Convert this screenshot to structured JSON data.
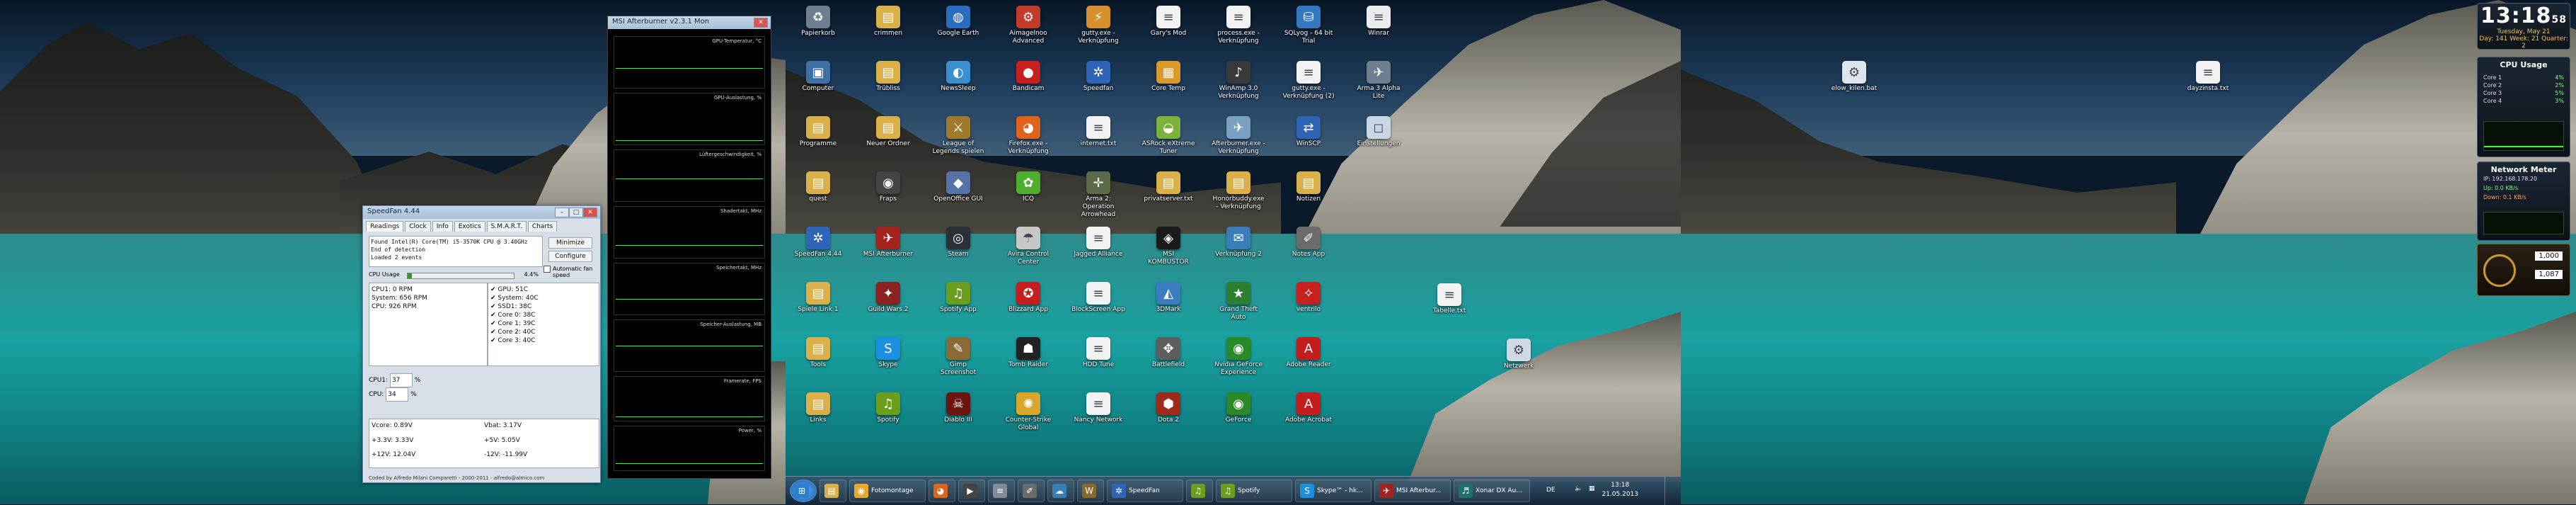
{
  "colors": {
    "lake": "#1aa1a1",
    "taskbar": "#23384f",
    "graph": "#34ff34",
    "gadget_accent": "#f3c24a"
  },
  "speedfan": {
    "title": "SpeedFan 4.44",
    "tabs": [
      "Readings",
      "Clock",
      "Info",
      "Exotics",
      "S.M.A.R.T.",
      "Charts"
    ],
    "log_lines": [
      "Found Intel(R) Core(TM) i5-3570K CPU @ 3.40GHz",
      "End of detection",
      "Loaded 2 events"
    ],
    "buttons": {
      "minimize": "Minimize",
      "configure": "Configure"
    },
    "auto_fan_label": "Automatic fan speed",
    "cpu_usage_label": "CPU Usage",
    "cpu_usage_value": "4.4%",
    "fans": [
      "CPU1: 0 RPM",
      "System: 656 RPM",
      "CPU: 926 RPM"
    ],
    "temps": [
      "GPU: 51C",
      "System: 40C",
      "SSD1: 38C",
      "Core 0: 38C",
      "Core 1: 39C",
      "Core 2: 40C",
      "Core 3: 40C"
    ],
    "speed_rows": [
      {
        "label": "CPU1:",
        "value": "37"
      },
      {
        "label": "CPU:",
        "value": "34"
      }
    ],
    "volts": [
      "Vcore: 0.89V",
      "Vbat: 3.17V",
      "+3.3V: 3.33V",
      "+5V: 5.05V",
      "+12V: 12.04V",
      "-12V: -11.99V"
    ],
    "footer": "Coded by Alfredo Milani Comparetti - 2000-2011 - alfredo@almico.com"
  },
  "afterburner": {
    "title": "MSI Afterburner v2.3.1 Mon",
    "graphs": [
      "GPU-Temperatur, °C",
      "GPU-Auslastung, %",
      "Lüftergeschwindigkeit, %",
      "Shadertakt, MHz",
      "Speichertakt, MHz",
      "Speicher-Auslastung, MB",
      "Framerate, FPS",
      "Power, %"
    ]
  },
  "desktop": {
    "icons": [
      {
        "label": "Papierkorb",
        "icon": "trash-icon",
        "color": "#6f7f8f",
        "glyph": "♻"
      },
      {
        "label": "Computer",
        "icon": "computer-icon",
        "color": "#3e6fa5",
        "glyph": "▣"
      },
      {
        "label": "Programme",
        "icon": "folder-icon",
        "color": "#d9b04a",
        "glyph": "▤"
      },
      {
        "label": "quest",
        "icon": "folder-icon",
        "color": "#d9b04a",
        "glyph": "▤"
      },
      {
        "label": "SpeedFan 4.44",
        "icon": "speedfan-icon",
        "color": "#2f64b8",
        "glyph": "✲"
      },
      {
        "label": "Spiele Link 1",
        "icon": "folder-icon",
        "color": "#d9b04a",
        "glyph": "▤"
      },
      {
        "label": "Tools",
        "icon": "folder-icon",
        "color": "#d9b04a",
        "glyph": "▤"
      },
      {
        "label": "Links",
        "icon": "folder-icon",
        "color": "#d9b04a",
        "glyph": "▤"
      },
      {
        "label": "crimmen",
        "icon": "folder-icon",
        "color": "#d9b04a",
        "glyph": "▤"
      },
      {
        "label": "Trübliss",
        "icon": "folder-icon",
        "color": "#d9b04a",
        "glyph": "▤"
      },
      {
        "label": "Neuer Ordner",
        "icon": "folder-icon",
        "color": "#d9b04a",
        "glyph": "▤"
      },
      {
        "label": "Fraps",
        "icon": "fraps-icon",
        "color": "#444",
        "glyph": "◉"
      },
      {
        "label": "MSI Afterburner",
        "icon": "afterburner-icon",
        "color": "#a3241f",
        "glyph": "✈"
      },
      {
        "label": "Guild Wars 2",
        "icon": "game-icon",
        "color": "#8a2320",
        "glyph": "✦"
      },
      {
        "label": "Skype",
        "icon": "skype-icon",
        "color": "#1d8fe0",
        "glyph": "S"
      },
      {
        "label": "Spotify",
        "icon": "spotify-icon",
        "color": "#6a9e1c",
        "glyph": "♫"
      },
      {
        "label": "Google Earth",
        "icon": "earth-icon",
        "color": "#2a6dbf",
        "glyph": "◍"
      },
      {
        "label": "NewsSleep",
        "icon": "app-icon",
        "color": "#3a8fcf",
        "glyph": "◐"
      },
      {
        "label": "League of Legends spielen",
        "icon": "game-icon",
        "color": "#9d7a2c",
        "glyph": "⚔"
      },
      {
        "label": "OpenOffice GUI",
        "icon": "app-icon",
        "color": "#5672a6",
        "glyph": "◆"
      },
      {
        "label": "Steam",
        "icon": "steam-icon",
        "color": "#2a2f38",
        "glyph": "◎"
      },
      {
        "label": "Spotify App",
        "icon": "spotify-icon",
        "color": "#6a9e1c",
        "glyph": "♫"
      },
      {
        "label": "Gimp Screenshot",
        "icon": "gimp-icon",
        "color": "#8a6a38",
        "glyph": "✎"
      },
      {
        "label": "Diablo III",
        "icon": "game-icon",
        "color": "#6b1510",
        "glyph": "☠"
      },
      {
        "label": "Aimagelnoo Advanced",
        "icon": "app-icon",
        "color": "#c13a2a",
        "glyph": "⚙"
      },
      {
        "label": "Bandicam",
        "icon": "record-icon",
        "color": "#c62020",
        "glyph": "●"
      },
      {
        "label": "Firefox.exe - Verknüpfung",
        "icon": "firefox-icon",
        "color": "#e0631d",
        "glyph": "◕"
      },
      {
        "label": "ICQ",
        "icon": "icq-icon",
        "color": "#4fae2e",
        "glyph": "✿"
      },
      {
        "label": "Avira Control Center",
        "icon": "avira-icon",
        "color": "#c7c7c7",
        "glyph": "☂"
      },
      {
        "label": "Blizzard App",
        "icon": "game-icon",
        "color": "#c41e1e",
        "glyph": "✪"
      },
      {
        "label": "Tomb Raider",
        "icon": "game-icon",
        "color": "#222",
        "glyph": "☗"
      },
      {
        "label": "Counter-Strike Global",
        "icon": "game-icon",
        "color": "#d9a52a",
        "glyph": "✺"
      },
      {
        "label": "gutty.exe - Verknüpfung",
        "icon": "app-icon",
        "color": "#d88f2d",
        "glyph": "⚡"
      },
      {
        "label": "Speedfan",
        "icon": "speedfan-icon",
        "color": "#2f64b8",
        "glyph": "✲"
      },
      {
        "label": "internet.txt",
        "icon": "text-file-icon",
        "color": "#f2f2f2",
        "glyph": "≡"
      },
      {
        "label": "Arma 2: Operation Arrowhead",
        "icon": "game-icon",
        "color": "#5d6b4a",
        "glyph": "✛"
      },
      {
        "label": "Jagged Alliance",
        "icon": "text-file-icon",
        "color": "#f2f2f2",
        "glyph": "≡"
      },
      {
        "label": "BlockScreen App",
        "icon": "text-file-icon",
        "color": "#f2f2f2",
        "glyph": "≡"
      },
      {
        "label": "HDD Tune",
        "icon": "text-file-icon",
        "color": "#f2f2f2",
        "glyph": "≡"
      },
      {
        "label": "Nancy Network",
        "icon": "text-file-icon",
        "color": "#f2f2f2",
        "glyph": "≡"
      },
      {
        "label": "Gary's Mod",
        "icon": "text-file-icon",
        "color": "#f2f2f2",
        "glyph": "≡"
      },
      {
        "label": "Core Temp",
        "icon": "temp-icon",
        "color": "#d99a2b",
        "glyph": "▦"
      },
      {
        "label": "ASRock eXtreme Tuner",
        "icon": "app-icon",
        "color": "#7ab23b",
        "glyph": "◒"
      },
      {
        "label": "privatserver.txt",
        "icon": "folder-icon",
        "color": "#d9b04a",
        "glyph": "▤"
      },
      {
        "label": "MSI KOMBUSTOR",
        "icon": "app-icon",
        "color": "#1a1a1a",
        "glyph": "◈"
      },
      {
        "label": "3DMark",
        "icon": "app-icon",
        "color": "#3b7dc0",
        "glyph": "◭"
      },
      {
        "label": "Battlefield",
        "icon": "game-icon",
        "color": "#5e5e5e",
        "glyph": "✥"
      },
      {
        "label": "Dota 2",
        "icon": "game-icon",
        "color": "#9e2a1c",
        "glyph": "⬢"
      },
      {
        "label": "process.exe - Verknüpfung",
        "icon": "text-file-icon",
        "color": "#f2f2f2",
        "glyph": "≡"
      },
      {
        "label": "WinAmp 3.0 Verknüpfung",
        "icon": "app-icon",
        "color": "#3a3a3a",
        "glyph": "♪"
      },
      {
        "label": "Afterburner.exe - Verknüpfung",
        "icon": "app-icon",
        "color": "#7aa0c4",
        "glyph": "✈"
      },
      {
        "label": "Honorbuddy.exe - Verknüpfung",
        "icon": "folder-icon",
        "color": "#d9b04a",
        "glyph": "▤"
      },
      {
        "label": "Verknüpfung 2",
        "icon": "mail-icon",
        "color": "#3a7db8",
        "glyph": "✉"
      },
      {
        "label": "Grand Theft Auto",
        "icon": "game-icon",
        "color": "#2f7f33",
        "glyph": "★"
      },
      {
        "label": "Nvidia GeForce Experience",
        "icon": "nvidia-icon",
        "color": "#2a8a2a",
        "glyph": "◉"
      },
      {
        "label": "GeForce",
        "icon": "nvidia-icon",
        "color": "#2a8a2a",
        "glyph": "◉"
      },
      {
        "label": "SQLyog - 64 bit Trial",
        "icon": "database-icon",
        "color": "#3277c0",
        "glyph": "⛁"
      },
      {
        "label": "gutty.exe - Verknüpfung (2)",
        "icon": "text-file-icon",
        "color": "#f2f2f2",
        "glyph": "≡"
      },
      {
        "label": "WinSCP",
        "icon": "winscp-icon",
        "color": "#2f63b3",
        "glyph": "⇄"
      },
      {
        "label": "Notizen",
        "icon": "folder-icon",
        "color": "#d9b04a",
        "glyph": "▤"
      },
      {
        "label": "Notes App",
        "icon": "app-icon",
        "color": "#6b6b6b",
        "glyph": "✐"
      },
      {
        "label": "ventrilo",
        "icon": "app-icon",
        "color": "#c62020",
        "glyph": "✧"
      },
      {
        "label": "Adobe Reader",
        "icon": "pdf-icon",
        "color": "#c41d1d",
        "glyph": "A"
      },
      {
        "label": "Adobe Acrobat",
        "icon": "pdf-icon",
        "color": "#c41d1d",
        "glyph": "A"
      },
      {
        "label": "Winrar",
        "icon": "app-icon",
        "color": "#ececec",
        "glyph": "≡"
      },
      {
        "label": "Arma 3 Alpha Lite",
        "icon": "game-icon",
        "color": "#6f7f8f",
        "glyph": "✈"
      },
      {
        "label": "Einstellungen",
        "icon": "app-icon",
        "color": "#c8d6e6",
        "glyph": "◻"
      }
    ],
    "second_monitor_icons": [
      {
        "label": "elow_kilen.bat",
        "icon": "batch-file-icon",
        "color": "#dfe5ec",
        "glyph": "⚙"
      },
      {
        "label": "dayzinsta.txt",
        "icon": "text-file-icon",
        "color": "#f2f2f2",
        "glyph": "≡"
      }
    ],
    "loose_icons": [
      {
        "label": "Tabelle.txt",
        "icon": "text-file-icon",
        "color": "#f2f2f2",
        "glyph": "≡"
      },
      {
        "label": "Netzwerk",
        "icon": "network-icon",
        "color": "#cfd9e4",
        "glyph": "⚙"
      }
    ]
  },
  "taskbar": {
    "items": [
      {
        "label": "",
        "icon": "start-orb-icon",
        "color": "#2d7fd1",
        "glyph": "⊞"
      },
      {
        "label": "",
        "icon": "explorer-icon",
        "color": "#d9b04a",
        "glyph": "▤"
      },
      {
        "label": "Fotomontage",
        "icon": "chrome-icon",
        "color": "#e8a92a",
        "glyph": "◉"
      },
      {
        "label": "",
        "icon": "firefox-icon",
        "color": "#e0631d",
        "glyph": "◕"
      },
      {
        "label": "",
        "icon": "media-icon",
        "color": "#444",
        "glyph": "▶"
      },
      {
        "label": "",
        "icon": "document-icon",
        "color": "#7f8d9b",
        "glyph": "≡"
      },
      {
        "label": "",
        "icon": "feather-icon",
        "color": "#6b6b6b",
        "glyph": "✐"
      },
      {
        "label": "",
        "icon": "cloud-icon",
        "color": "#3a7db8",
        "glyph": "☁"
      },
      {
        "label": "",
        "icon": "wow-icon",
        "color": "#8a6a2a",
        "glyph": "W"
      },
      {
        "label": "SpeedFan",
        "icon": "speedfan-icon",
        "color": "#2f64b8",
        "glyph": "✲"
      },
      {
        "label": "",
        "icon": "spotify-icon",
        "color": "#6a9e1c",
        "glyph": "♫"
      },
      {
        "label": "Spotify",
        "icon": "spotify-icon",
        "color": "#6a9e1c",
        "glyph": "♫"
      },
      {
        "label": "Skype™ - hk...",
        "icon": "skype-icon",
        "color": "#1d8fe0",
        "glyph": "S"
      },
      {
        "label": "MSI Afterbur...",
        "icon": "afterburner-icon",
        "color": "#a3241f",
        "glyph": "✈"
      },
      {
        "label": "Xonar DX Au...",
        "icon": "audio-icon",
        "color": "#1f6f6f",
        "glyph": "♬"
      }
    ],
    "tray": {
      "language": "DE",
      "time": "13:18",
      "date": "21.05.2013"
    }
  },
  "gadgets": {
    "clock": {
      "time": "13:18",
      "seconds": "58",
      "line1": "Tuesday, May 21",
      "line2": "Day: 141  Week: 21  Quarter: 2"
    },
    "cpu": {
      "title": "CPU Usage",
      "cores": [
        {
          "label": "Core 1",
          "value": "4%"
        },
        {
          "label": "Core 2",
          "value": "2%"
        },
        {
          "label": "Core 3",
          "value": "5%"
        },
        {
          "label": "Core 4",
          "value": "3%"
        }
      ],
      "usage": 0.04
    },
    "network": {
      "title": "Network Meter",
      "line1": "IP: 192.168.178.20",
      "line2": "Up: 0.0 KB/s",
      "line3": "Down: 0.1 KB/s"
    },
    "meter": {
      "values": [
        "1,000",
        "1,087"
      ]
    }
  }
}
